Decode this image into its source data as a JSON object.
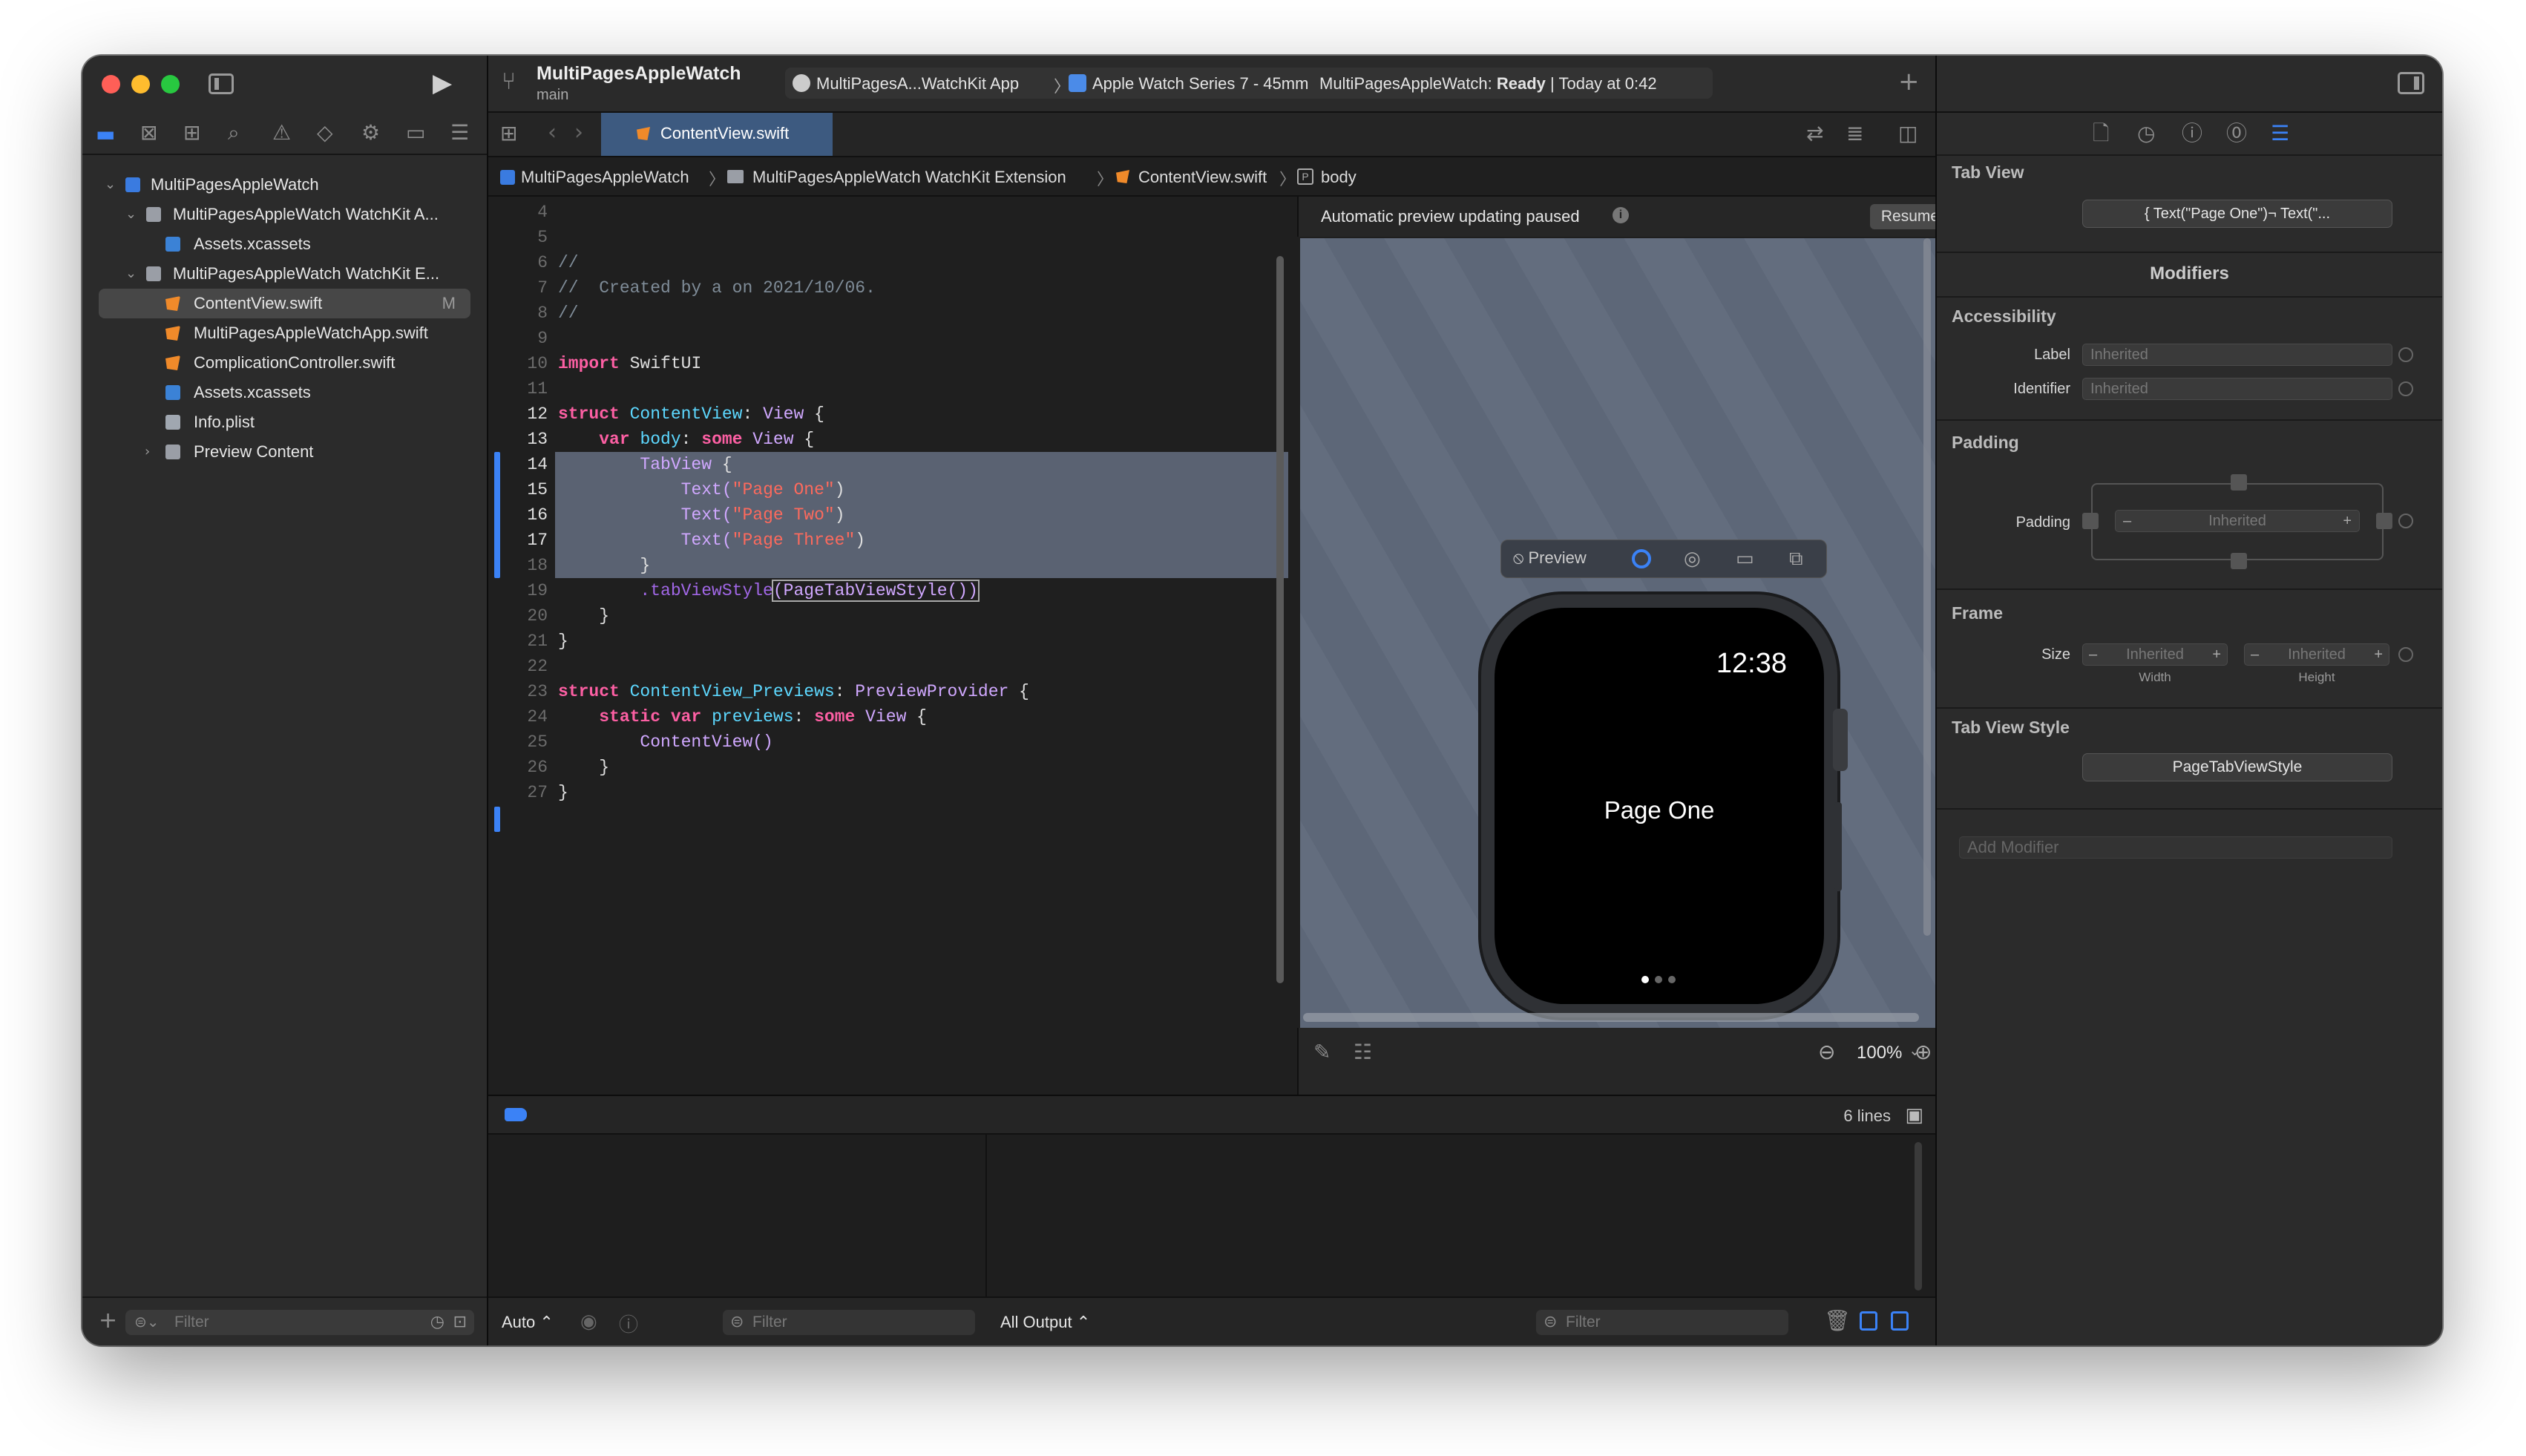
{
  "toolbar": {
    "project": "MultiPagesAppleWatch",
    "branch": "main",
    "scheme": "MultiPagesA...WatchKit App",
    "device": "Apple Watch Series 7 - 45mm",
    "status_prefix": "MultiPagesAppleWatch:",
    "status_state": "Ready",
    "status_time": "| Today at 0:42"
  },
  "tab": {
    "label": "ContentView.swift"
  },
  "breadcrumb": [
    "MultiPagesAppleWatch",
    "MultiPagesAppleWatch WatchKit Extension",
    "ContentView.swift",
    "body"
  ],
  "navigator": {
    "items": [
      {
        "label": "MultiPagesAppleWatch"
      },
      {
        "label": "MultiPagesAppleWatch WatchKit A..."
      },
      {
        "label": "Assets.xcassets"
      },
      {
        "label": "MultiPagesAppleWatch WatchKit E..."
      },
      {
        "label": "ContentView.swift",
        "badge": "M"
      },
      {
        "label": "MultiPagesAppleWatchApp.swift"
      },
      {
        "label": "ComplicationController.swift"
      },
      {
        "label": "Assets.xcassets"
      },
      {
        "label": "Info.plist"
      },
      {
        "label": "Preview Content"
      }
    ],
    "filter_placeholder": "Filter"
  },
  "code": {
    "line_numbers": [
      "4",
      "5",
      "6",
      "7",
      "8",
      "9",
      "10",
      "11",
      "12",
      "13",
      "14",
      "15",
      "16",
      "17",
      "18",
      "19",
      "20",
      "21",
      "22",
      "23",
      "24",
      "25",
      "26",
      "27"
    ],
    "l4": "//",
    "l5": "//  Created by a on 2021/10/06.",
    "l6": "//",
    "import_kw": "import",
    "import_mod": " SwiftUI",
    "struct_kw": "struct",
    "cv_name": " ContentView",
    "colon": ": ",
    "view_type": "View",
    "brace_open": " {",
    "var_kw": "var",
    "body_name": " body",
    "some_kw": "some",
    "tabview": "TabView",
    "text_fn": "Text(",
    "page_one": "\"Page One\"",
    "page_two": "\"Page Two\"",
    "page_three": "\"Page Three\"",
    "close_paren": ")",
    "close_brace": "}",
    "tvs_mod": ".tabViewStyle",
    "tvs_arg": "(PageTabViewStyle())",
    "preview_name": " ContentView_Previews",
    "preview_provider": "PreviewProvider",
    "static_kw": "static",
    "previews_name": " previews",
    "cv_call": "ContentView()"
  },
  "preview": {
    "paused_text": "Automatic preview updating paused",
    "resume_label": "Resume",
    "preview_label": "Preview",
    "watch_time": "12:38",
    "watch_text": "Page One",
    "zoom": "100%"
  },
  "debug": {
    "lines_count": "6 lines",
    "auto_label": "Auto",
    "all_output": "All Output",
    "filter_placeholder": "Filter"
  },
  "inspector": {
    "tab_view_header": "Tab View",
    "tab_view_value": "{ Text(\"Page One\")¬ Text(\"...",
    "modifiers_header": "Modifiers",
    "accessibility_header": "Accessibility",
    "label_lbl": "Label",
    "identifier_lbl": "Identifier",
    "inherited": "Inherited",
    "padding_header": "Padding",
    "padding_lbl": "Padding",
    "frame_header": "Frame",
    "size_lbl": "Size",
    "width_lbl": "Width",
    "height_lbl": "Height",
    "tvs_header": "Tab View Style",
    "tvs_value": "PageTabViewStyle",
    "add_modifier": "Add Modifier"
  }
}
